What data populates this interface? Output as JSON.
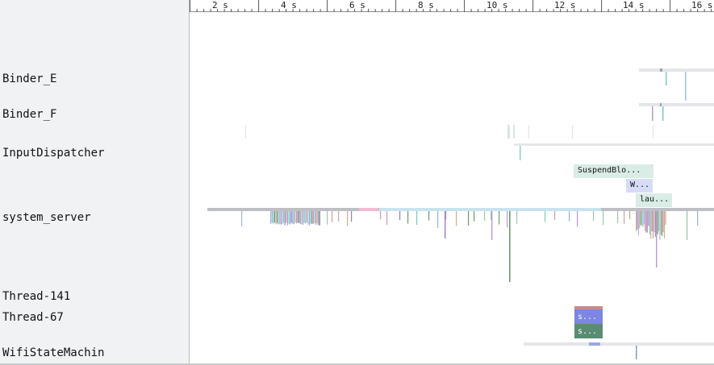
{
  "ruler": {
    "ticks": [
      "2 s",
      "4 s",
      "6 s",
      "8 s",
      "10 s",
      "12 s",
      "14 s",
      "16 s"
    ]
  },
  "tracks": [
    {
      "label": "Binder_E"
    },
    {
      "label": "Binder_F"
    },
    {
      "label": "InputDispatcher"
    },
    {
      "label": "system_server"
    },
    {
      "label": "Thread-141"
    },
    {
      "label": "Thread-67"
    },
    {
      "label": "WifiStateMachin"
    }
  ],
  "slices": {
    "suspend_blocker": "SuspendBlo...",
    "w_slice": "W...",
    "lau_slice": "lau...",
    "thread67_s1": "s...",
    "thread67_s2": "s..."
  },
  "colors": {
    "suspend_blocker": "#d9ece6",
    "w_slice": "#d6dcf6",
    "lau_slice": "#d9ece6",
    "thread67_top": "#7d86e2",
    "thread67_bottom": "#5a8c72",
    "thread67_cap": "#c98a86"
  }
}
